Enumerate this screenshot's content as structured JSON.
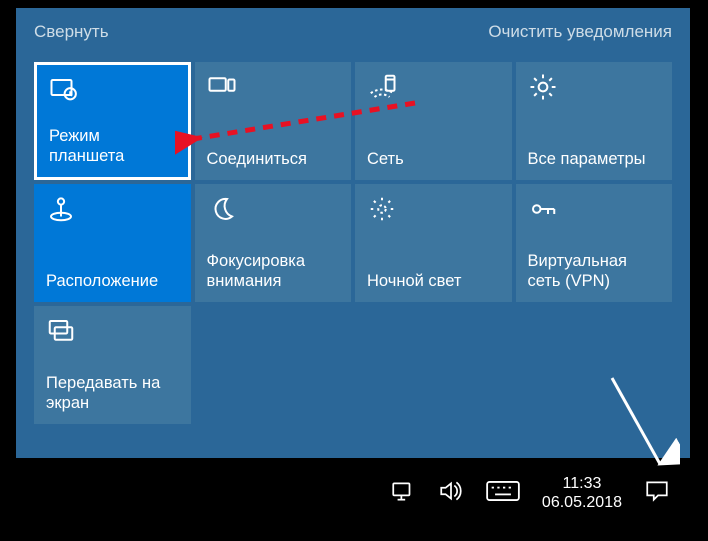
{
  "header": {
    "collapse": "Свернуть",
    "clear": "Очистить уведомления"
  },
  "tiles": {
    "tablet": {
      "label": "Режим планшета"
    },
    "connect": {
      "label": "Соединиться"
    },
    "network": {
      "label": "Сеть"
    },
    "allset": {
      "label": "Все параметры"
    },
    "location": {
      "label": "Расположение"
    },
    "focus": {
      "label": "Фокусировка внимания"
    },
    "night": {
      "label": "Ночной свет"
    },
    "vpn": {
      "label": "Виртуальная сеть (VPN)"
    },
    "project": {
      "label": "Передавать на экран"
    }
  },
  "taskbar": {
    "time": "11:33",
    "date": "06.05.2018"
  }
}
